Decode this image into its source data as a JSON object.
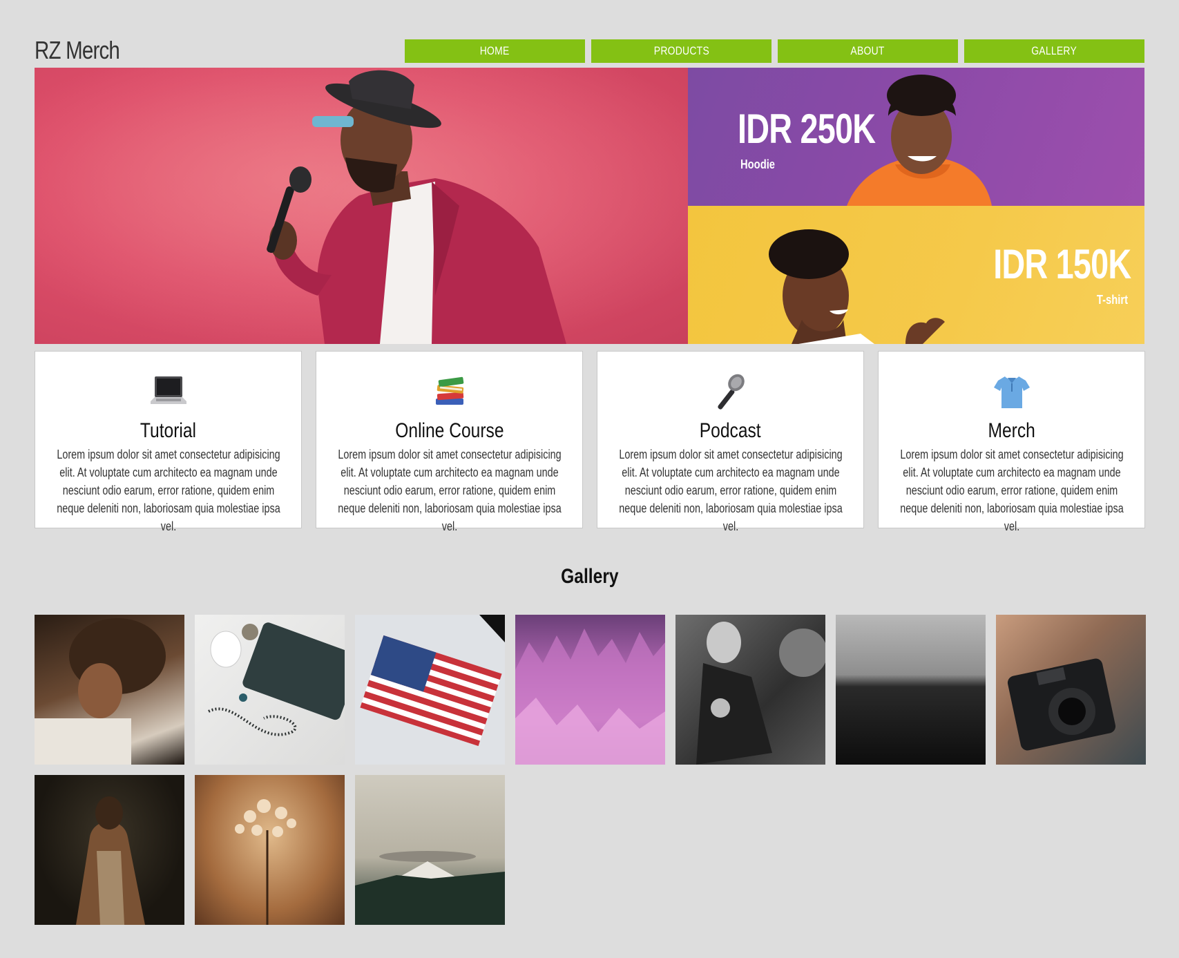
{
  "brand": "RZ Merch",
  "nav": [
    "HOME",
    "PRODUCTS",
    "ABOUT",
    "GALLERY"
  ],
  "hero": {
    "offer_top": {
      "price": "IDR 250K",
      "product": "Hoodie"
    },
    "offer_bottom": {
      "price": "IDR 150K",
      "product": "T-shirt"
    }
  },
  "features": [
    {
      "icon": "laptop-icon",
      "title": "Tutorial",
      "text": "Lorem ipsum dolor sit amet consectetur adipisicing elit. At voluptate cum architecto ea magnam unde nesciunt odio earum, error ratione, quidem enim neque deleniti non, laboriosam quia molestiae ipsa vel."
    },
    {
      "icon": "books-icon",
      "title": "Online Course",
      "text": "Lorem ipsum dolor sit amet consectetur adipisicing elit. At voluptate cum architecto ea magnam unde nesciunt odio earum, error ratione, quidem enim neque deleniti non, laboriosam quia molestiae ipsa vel."
    },
    {
      "icon": "microphone-icon",
      "title": "Podcast",
      "text": "Lorem ipsum dolor sit amet consectetur adipisicing elit. At voluptate cum architecto ea magnam unde nesciunt odio earum, error ratione, quidem enim neque deleniti non, laboriosam quia molestiae ipsa vel."
    },
    {
      "icon": "shirt-icon",
      "title": "Merch",
      "text": "Lorem ipsum dolor sit amet consectetur adipisicing elit. At voluptate cum architecto ea magnam unde nesciunt odio earum, error ratione, quidem enim neque deleniti non, laboriosam quia molestiae ipsa vel."
    }
  ],
  "gallery": {
    "title": "Gallery"
  },
  "colors": {
    "accent": "#84c114",
    "background": "#dddddd",
    "hero_pink": "#de4f6a",
    "hero_purple": "#8c4aa8",
    "hero_yellow": "#f5c94a"
  }
}
